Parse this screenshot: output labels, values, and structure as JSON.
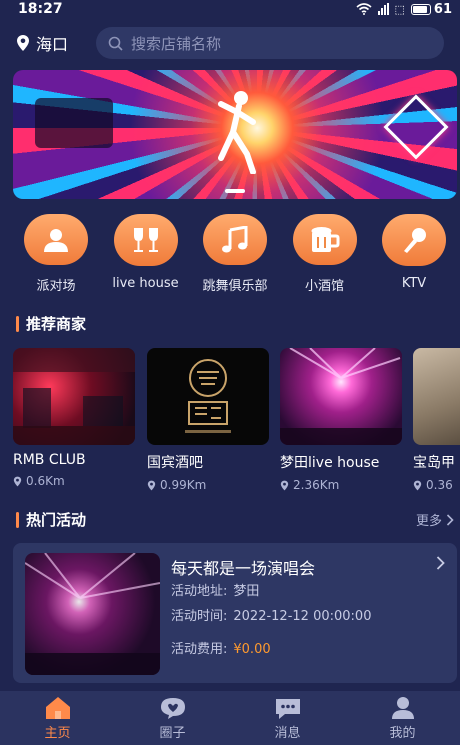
{
  "status": {
    "time": "18:27",
    "battery": "61"
  },
  "header": {
    "city": "海口",
    "search_placeholder": "搜索店铺名称"
  },
  "categories": [
    {
      "label": "派对场",
      "icon": "party-person-icon"
    },
    {
      "label": "live house",
      "icon": "wine-glasses-icon"
    },
    {
      "label": "跳舞俱乐部",
      "icon": "music-note-icon"
    },
    {
      "label": "小酒馆",
      "icon": "beer-mug-icon"
    },
    {
      "label": "KTV",
      "icon": "microphone-icon"
    }
  ],
  "recommended": {
    "title": "推荐商家",
    "merchants": [
      {
        "name": "RMB CLUB",
        "distance": "0.6Km"
      },
      {
        "name": "国宾酒吧",
        "distance": "0.99Km"
      },
      {
        "name": "梦田live house",
        "distance": "2.36Km"
      },
      {
        "name": "宝岛甲",
        "distance": "0.36"
      }
    ]
  },
  "events": {
    "title": "热门活动",
    "more_label": "更多",
    "items": [
      {
        "title": "每天都是一场演唱会",
        "address_label": "活动地址:",
        "address": "梦田",
        "time_label": "活动时间:",
        "time": "2022-12-12 00:00:00",
        "fee_label": "活动费用:",
        "fee": "¥0.00"
      }
    ]
  },
  "tabs": [
    {
      "label": "主页",
      "icon": "home-icon",
      "active": true
    },
    {
      "label": "圈子",
      "icon": "circle-chat-icon",
      "active": false
    },
    {
      "label": "消息",
      "icon": "message-icon",
      "active": false
    },
    {
      "label": "我的",
      "icon": "profile-icon",
      "active": false
    }
  ],
  "colors": {
    "background": "#1f2550",
    "accent": "#ff8a4a",
    "fee": "#ff9a2e",
    "card": "#2e3764"
  }
}
